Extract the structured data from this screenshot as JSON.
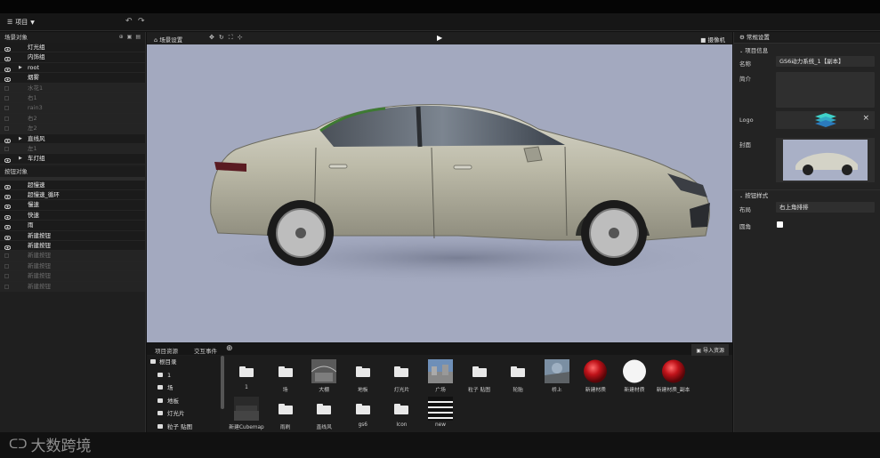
{
  "header": {
    "menu_label": "项目",
    "undo_icon": "undo-icon",
    "redo_icon": "redo-icon"
  },
  "scene_tree": {
    "title": "场景对象",
    "items": [
      {
        "label": "灯光组",
        "visible": true,
        "expandable": false
      },
      {
        "label": "内饰组",
        "visible": true,
        "expandable": false
      },
      {
        "label": "root",
        "visible": true,
        "expandable": true
      },
      {
        "label": "烟雾",
        "visible": true,
        "expandable": false
      },
      {
        "label": "水花1",
        "visible": false,
        "expandable": false
      },
      {
        "label": "右1",
        "visible": false,
        "expandable": false
      },
      {
        "label": "rain3",
        "visible": false,
        "expandable": false
      },
      {
        "label": "右2",
        "visible": false,
        "expandable": false
      },
      {
        "label": "左2",
        "visible": false,
        "expandable": false
      },
      {
        "label": "直线风",
        "visible": true,
        "expandable": true
      },
      {
        "label": "左1",
        "visible": false,
        "expandable": false
      },
      {
        "label": "车灯组",
        "visible": true,
        "expandable": true
      }
    ]
  },
  "button_tree": {
    "title": "按钮对象",
    "items": [
      {
        "label": "超慢速",
        "visible": true
      },
      {
        "label": "超慢速_循环",
        "visible": true
      },
      {
        "label": "慢速",
        "visible": true
      },
      {
        "label": "快速",
        "visible": true
      },
      {
        "label": "雨",
        "visible": true
      },
      {
        "label": "新建按钮",
        "visible": true
      },
      {
        "label": "新建按钮",
        "visible": true
      },
      {
        "label": "新建按钮",
        "visible": false
      },
      {
        "label": "新建按钮",
        "visible": false
      },
      {
        "label": "新建按钮",
        "visible": false
      },
      {
        "label": "新建按钮",
        "visible": false
      }
    ]
  },
  "viewport_toolbar": {
    "scene_settings": "场景设置",
    "camera": "摄像机"
  },
  "assets": {
    "tabs": [
      "项目资源",
      "交互事件"
    ],
    "import_label": "导入资源",
    "dirs": [
      {
        "label": "根目录",
        "indent": 0
      },
      {
        "label": "1",
        "indent": 1
      },
      {
        "label": "场",
        "indent": 1
      },
      {
        "label": "地板",
        "indent": 1
      },
      {
        "label": "灯光片",
        "indent": 1
      },
      {
        "label": "粒子 贴图",
        "indent": 1
      }
    ],
    "items": [
      {
        "label": "1",
        "kind": "folder"
      },
      {
        "label": "场",
        "kind": "folder"
      },
      {
        "label": "大棚",
        "kind": "hdri"
      },
      {
        "label": "地板",
        "kind": "folder"
      },
      {
        "label": "灯光片",
        "kind": "folder"
      },
      {
        "label": "广场",
        "kind": "sky"
      },
      {
        "label": "粒子 贴图",
        "kind": "folder"
      },
      {
        "label": "轮胎",
        "kind": "folder"
      },
      {
        "label": "桥上",
        "kind": "pano"
      },
      {
        "label": "新建材质",
        "kind": "red-sphere"
      },
      {
        "label": "新建材质",
        "kind": "white-sphere"
      },
      {
        "label": "新建材质_副本",
        "kind": "red-sphere"
      },
      {
        "label": "新建Cubemap",
        "kind": "cubemap"
      },
      {
        "label": "雨刷",
        "kind": "folder"
      },
      {
        "label": "直线风",
        "kind": "folder"
      },
      {
        "label": "gs6",
        "kind": "folder"
      },
      {
        "label": "Icon",
        "kind": "folder"
      },
      {
        "label": "new",
        "kind": "stripes"
      }
    ]
  },
  "properties": {
    "title": "常规设置",
    "project_info": "项目信息",
    "name_label": "名称",
    "name_value": "GS6动力系统_1【副本】",
    "intro_label": "简介",
    "logo_label": "Logo",
    "logo_close": "×",
    "cover_label": "封面",
    "button_style": "按钮样式",
    "layout_label": "布局",
    "layout_value": "右上角排排",
    "rounded_label": "圆角"
  },
  "watermark": "大数跨境",
  "colors": {
    "viewport_bg": "#a3a9bf",
    "panel_bg": "#1f1f1f",
    "red_material": "#c0131a"
  }
}
